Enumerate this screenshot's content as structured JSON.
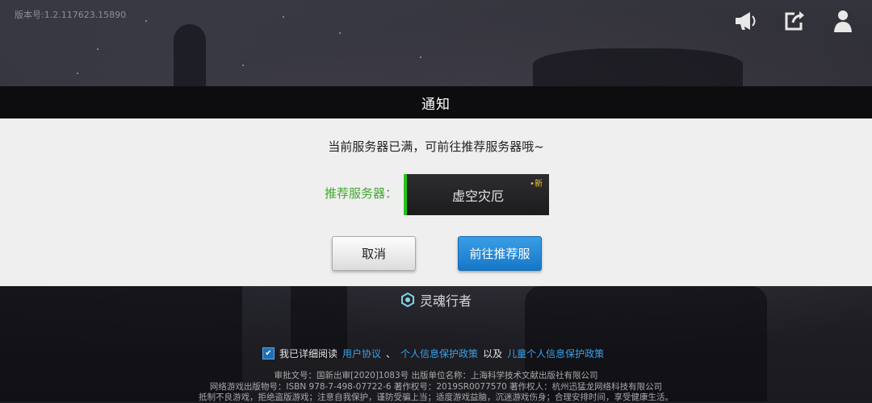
{
  "version_text": "版本号:1.2.117623.15890",
  "top_icons": [
    "megaphone-icon",
    "share-icon",
    "user-icon"
  ],
  "dialog": {
    "title": "通知",
    "message": "当前服务器已满，可前往推荐服务器哦~",
    "recommended_label": "推荐服务器：",
    "server_name": "虚空灾厄",
    "server_badge": "新",
    "cancel_label": "取消",
    "go_label": "前往推荐服"
  },
  "game_label": "灵魂行者",
  "agreement": {
    "prefix": "我已详细阅读",
    "link1": "用户协议",
    "sep": "、",
    "link2": "个人信息保护政策",
    "mid": "以及",
    "link3": "儿童个人信息保护政策"
  },
  "legal": {
    "line1": "审批文号：国新出审[2020]1083号    出版单位名称：上海科学技术文献出版社有限公司",
    "line2": "网络游戏出版物号：ISBN 978-7-498-07722-6    著作权号：2019SR0077570    著作权人：杭州迅猛龙网络科技有限公司",
    "line3": "抵制不良游戏，拒绝盗版游戏；注意自我保护，谨防受骗上当；适度游戏益脑，沉迷游戏伤身；合理安排时间，享受健康生活。"
  },
  "colors": {
    "accent_green": "#26c21b",
    "primary_blue": "#1e80d0",
    "link_blue": "#3aa1ea"
  }
}
